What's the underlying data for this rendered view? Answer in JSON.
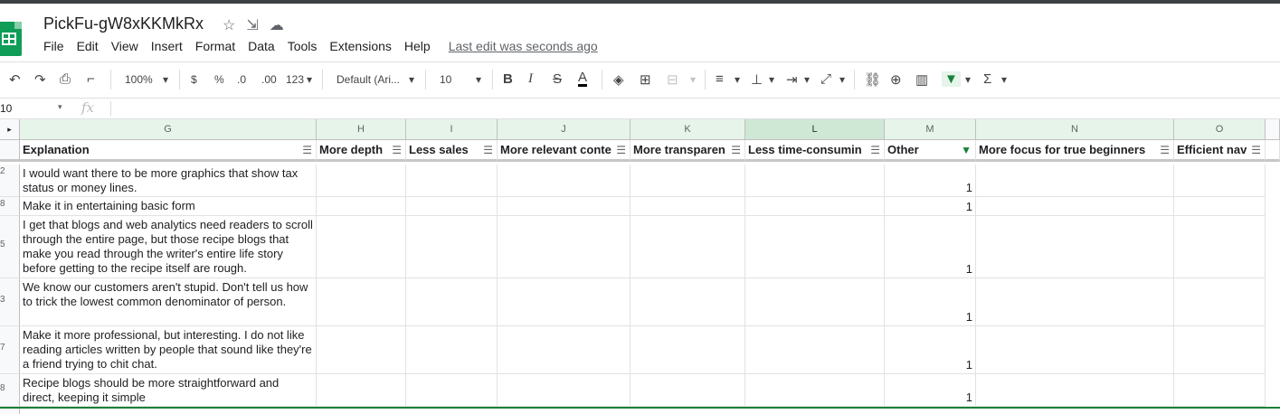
{
  "doc": {
    "title": "PickFu-gW8xKKMkRx"
  },
  "menu": {
    "items": [
      "File",
      "Edit",
      "View",
      "Insert",
      "Format",
      "Data",
      "Tools",
      "Extensions",
      "Help"
    ],
    "last_edit": "Last edit was seconds ago"
  },
  "toolbar": {
    "zoom": "100%",
    "currency": "$",
    "percent": "%",
    "dec_decrease": ".0",
    "dec_increase": ".00",
    "more_formats": "123",
    "font": "Default (Ari...",
    "font_size": "10"
  },
  "formula_bar": {
    "cell_ref": "10",
    "fx": "fx",
    "value": ""
  },
  "columns": [
    {
      "letter": "G",
      "header": "Explanation",
      "filtered": false
    },
    {
      "letter": "H",
      "header": "More depth",
      "filtered": false
    },
    {
      "letter": "I",
      "header": "Less sales",
      "filtered": false
    },
    {
      "letter": "J",
      "header": "More relevant conte",
      "filtered": false
    },
    {
      "letter": "K",
      "header": "More transparen",
      "filtered": false
    },
    {
      "letter": "L",
      "header": "Less time-consumin",
      "filtered": false
    },
    {
      "letter": "M",
      "header": "Other",
      "filtered": true
    },
    {
      "letter": "N",
      "header": "More focus for true beginners",
      "filtered": false
    },
    {
      "letter": "O",
      "header": "Efficient nav",
      "filtered": false
    }
  ],
  "rows": [
    {
      "num": "2",
      "explanation": "I would want there to be more graphics that show tax status or money lines.",
      "other": "1"
    },
    {
      "num": "8",
      "explanation": "Make it in entertaining basic form",
      "other": "1"
    },
    {
      "num": "5",
      "explanation": "I get that blogs and web analytics need readers to scroll through the entire page, but those recipe blogs that make you read through the writer's entire life story before getting to the recipe itself are rough.",
      "other": "1"
    },
    {
      "num": "3",
      "explanation": "We know our customers aren't stupid. Don't tell us how to trick the lowest common denominator of person.",
      "other": "1"
    },
    {
      "num": "7",
      "explanation": "Make it more professional, but interesting. I do not like reading articles written by people that sound like they're a friend trying to chit chat.",
      "other": "1"
    },
    {
      "num": "8",
      "explanation": "Recipe blogs should be more straightforward and direct, keeping it simple",
      "other": "1"
    }
  ]
}
